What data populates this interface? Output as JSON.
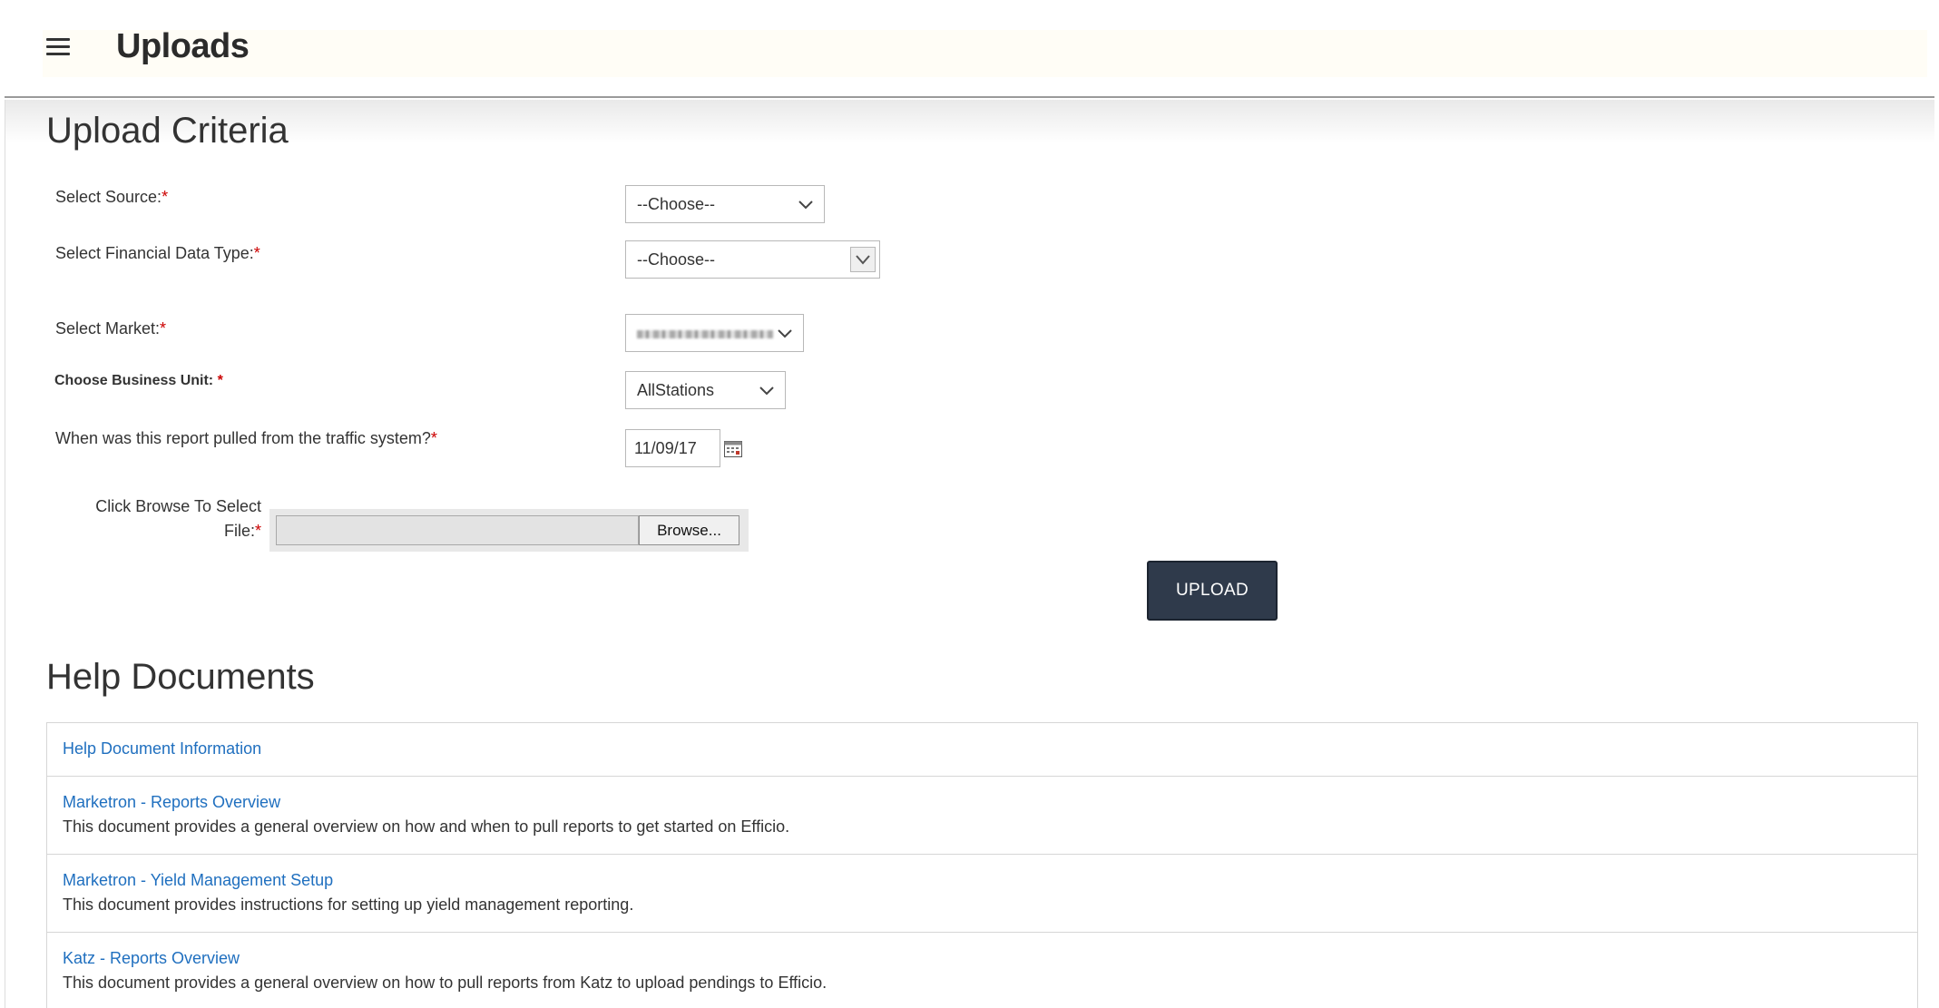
{
  "header": {
    "title": "Uploads",
    "menu_icon": "hamburger-menu-icon"
  },
  "upload_criteria": {
    "title": "Upload Criteria",
    "source": {
      "label": "Select Source:",
      "required": "*",
      "value": "--Choose--"
    },
    "financial_data_type": {
      "label": "Select Financial Data Type:",
      "required": "*",
      "value": "--Choose--"
    },
    "market": {
      "label": "Select Market:",
      "required": "*",
      "value": ""
    },
    "business_unit": {
      "label": "Choose Business Unit: ",
      "required": "*",
      "value": "AllStations"
    },
    "report_date": {
      "label": "When was this report pulled from the traffic system?",
      "required": "*",
      "value": "11/09/17"
    },
    "file": {
      "label_line1": "Click Browse To Select",
      "label_line2": "File:",
      "required": "*",
      "value": "",
      "browse_label": "Browse..."
    },
    "upload_label": "UPLOAD"
  },
  "help_documents": {
    "title": "Help Documents",
    "header_link": "Help Document Information",
    "items": [
      {
        "title": "Marketron - Reports Overview",
        "description": "This document provides a general overview on how and when to pull reports to get started on Efficio."
      },
      {
        "title": "Marketron - Yield Management Setup",
        "description": "This document provides instructions for setting up yield management reporting."
      },
      {
        "title": "Katz - Reports Overview",
        "description": "This document provides a general overview on how to pull reports from Katz to upload pendings to Efficio."
      }
    ]
  },
  "colors": {
    "accent_link": "#1f6fbf",
    "required": "#cc0000",
    "upload_button": "#2f3a4b"
  }
}
